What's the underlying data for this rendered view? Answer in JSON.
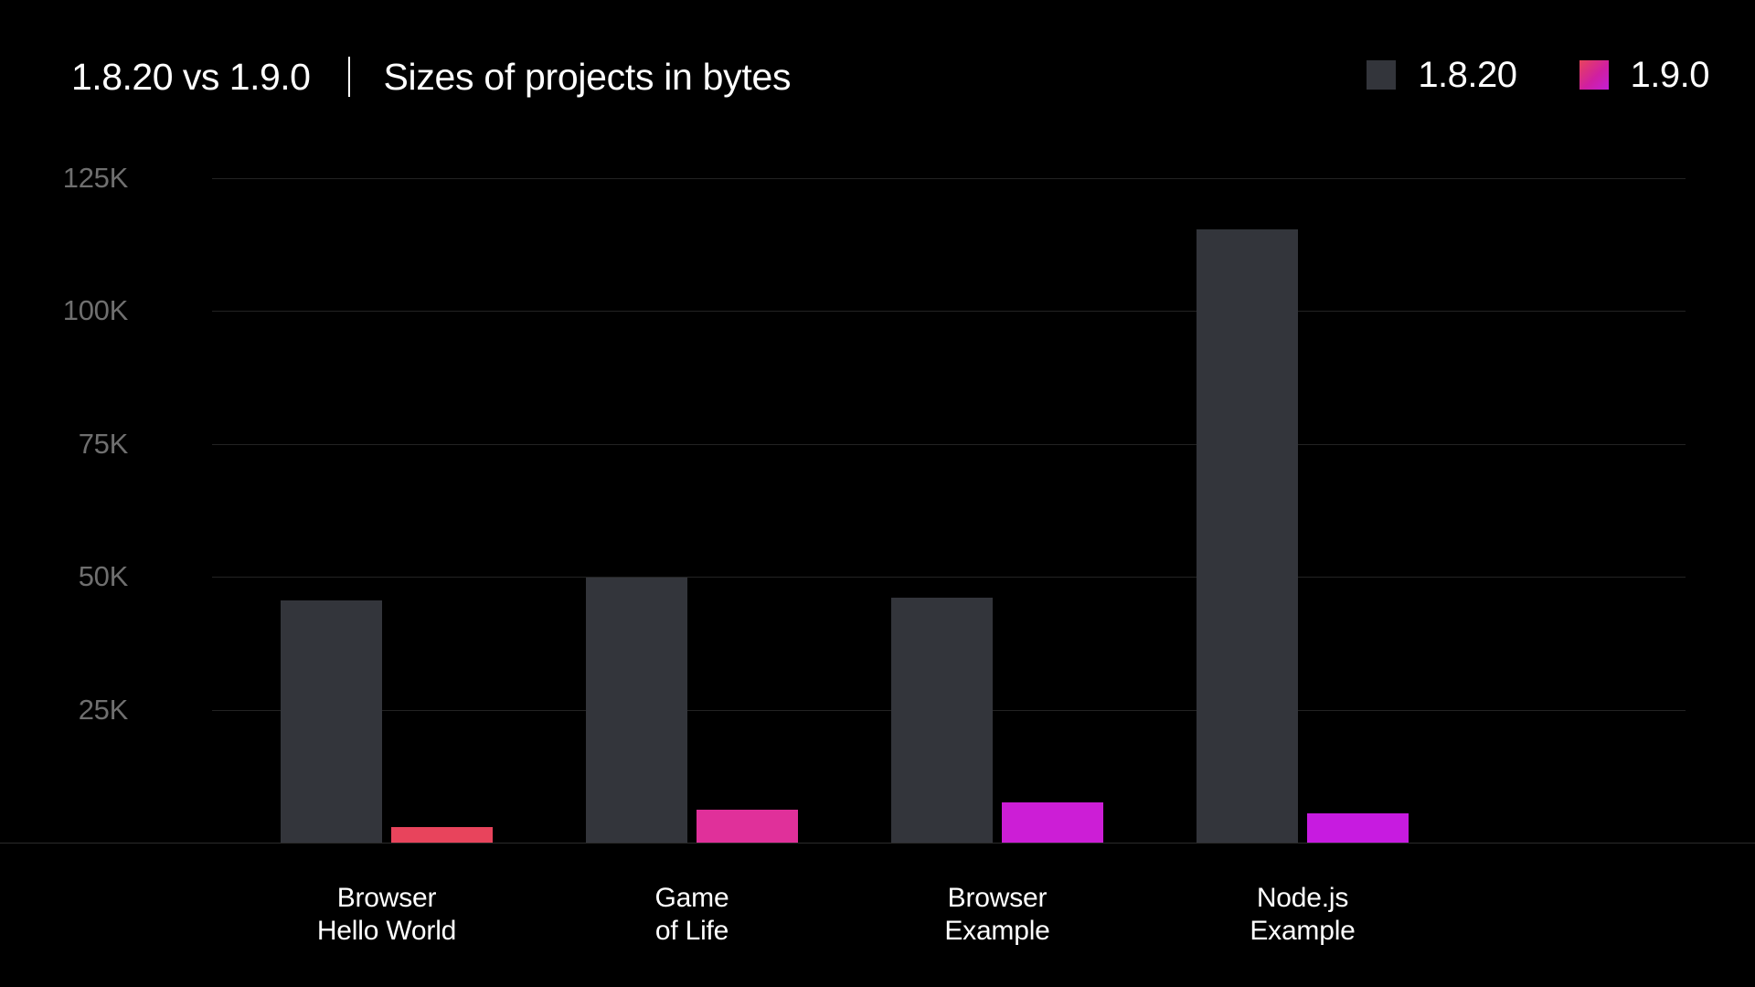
{
  "header": {
    "title_versions": "1.8.20 vs 1.9.0",
    "title_subject": "Sizes of projects in bytes"
  },
  "legend": {
    "position": "top-right",
    "items": [
      {
        "label": "1.8.20",
        "color": "#33353B"
      },
      {
        "label": "1.9.0",
        "color": "#D01FA0"
      }
    ]
  },
  "chart_data": {
    "type": "bar",
    "title": "1.8.20 vs 1.9.0  |  Sizes of projects in bytes",
    "xlabel": "",
    "ylabel": "",
    "ylim": [
      0,
      131000
    ],
    "grid": true,
    "legend_position": "top-right",
    "categories": [
      "Browser\nHello World",
      "Game\nof Life",
      "Browser\nExample",
      "Node.js\nExample"
    ],
    "category_lines": [
      [
        "Browser",
        "Hello World"
      ],
      [
        "Game",
        "of Life"
      ],
      [
        "Browser",
        "Example"
      ],
      [
        "Node.js",
        "Example"
      ]
    ],
    "ytick_values": [
      25000,
      50000,
      75000,
      100000,
      125000
    ],
    "yticks": [
      "25K",
      "50K",
      "75K",
      "100K",
      "125K"
    ],
    "series": [
      {
        "name": "1.8.20",
        "color": "#33353B",
        "values": [
          45500,
          49800,
          46000,
          115300
        ]
      },
      {
        "name": "1.9.0",
        "colors": [
          "#E8445C",
          "#E0309A",
          "#CC1ED6",
          "#C71BE0"
        ],
        "values": [
          2900,
          6200,
          7600,
          5500
        ]
      }
    ]
  },
  "colors": {
    "background": "#000000",
    "bar_old": "#33353B",
    "gridline": "#232323",
    "axis_text": "#6F6F6F",
    "text": "#FFFFFF"
  }
}
